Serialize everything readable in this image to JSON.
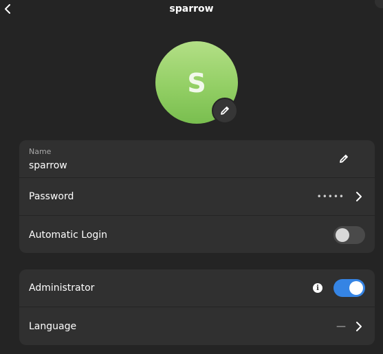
{
  "header": {
    "title": "sparrow",
    "back_icon": "chevron-left-icon"
  },
  "avatar": {
    "initial": "S",
    "color_top": "#b3df86",
    "color_bottom": "#79be4f",
    "edit_icon": "pencil-icon"
  },
  "account": {
    "name_caption": "Name",
    "name_value": "sparrow",
    "password_label": "Password",
    "password_mask": "•••••",
    "auto_login_label": "Automatic Login",
    "auto_login_enabled": false
  },
  "privileges": {
    "administrator_label": "Administrator",
    "administrator_enabled": true,
    "info_icon": "info-icon",
    "info_glyph": "i",
    "language_label": "Language",
    "language_value": "—"
  },
  "colors": {
    "background": "#242424",
    "card": "#303030",
    "accent": "#3584e4"
  }
}
